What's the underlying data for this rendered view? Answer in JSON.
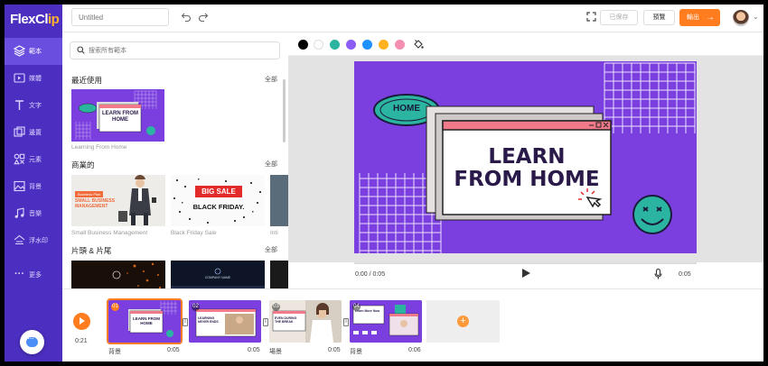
{
  "app": {
    "logo_main": "FlexCl",
    "logo_accent": "ip"
  },
  "sidebar": {
    "items": [
      {
        "label": "範本",
        "icon": "layers-icon"
      },
      {
        "label": "媒體",
        "icon": "media-icon"
      },
      {
        "label": "文字",
        "icon": "text-icon"
      },
      {
        "label": "邊置",
        "icon": "overlay-icon"
      },
      {
        "label": "元素",
        "icon": "elements-icon"
      },
      {
        "label": "背景",
        "icon": "background-icon"
      },
      {
        "label": "音樂",
        "icon": "music-icon"
      },
      {
        "label": "浮水印",
        "icon": "watermark-icon"
      },
      {
        "label": "更多",
        "icon": "more-icon"
      }
    ],
    "active_index": 0
  },
  "topbar": {
    "title_placeholder": "Untitled",
    "saved_label": "已保存",
    "preview_label": "預覽",
    "export_label": "輸出"
  },
  "library": {
    "search_placeholder": "搜索所有範本",
    "sections": [
      {
        "title": "最近使用",
        "all_label": "全部",
        "items": [
          {
            "caption": "Learning From Home"
          }
        ]
      },
      {
        "title": "商業的",
        "all_label": "全部",
        "items": [
          {
            "caption": "Small Business Management"
          },
          {
            "caption": "Black Friday Sale"
          },
          {
            "caption": "Inti"
          }
        ]
      },
      {
        "title": "片頭 & 片尾",
        "all_label": "全部"
      }
    ],
    "thumb_texts": {
      "learn": "LEARN FROM HOME",
      "business_tag": "Business Plan",
      "business": "SMALL BUSINESS MANAGEMENT",
      "big_sale": "BIG SALE",
      "black_friday": "BLACK FRIDAY.",
      "company": "COMPANY NAME"
    }
  },
  "colors": {
    "palette": [
      "#000000",
      "#ffffff",
      "#2bb5a0",
      "#8b5cf6",
      "#1e90ff",
      "#ffb21e",
      "#f48fb1"
    ],
    "accent": "#ff7c1f",
    "brand": "#4c2fc0"
  },
  "canvas": {
    "home_label": "HOME",
    "headline_line1": "LEARN",
    "headline_line2": "FROM HOME"
  },
  "player": {
    "time_current": "0:00 / 0:05",
    "time_total": "0:05"
  },
  "timeline": {
    "current_time": "0:21",
    "clips": [
      {
        "num": "01",
        "label": "背景",
        "duration": "0:05",
        "text": "LEARN FROM HOME"
      },
      {
        "num": "02",
        "label": "",
        "duration": "0:05",
        "text": "LEARNING NEVER ENDS"
      },
      {
        "num": "03",
        "label": "場景",
        "duration": "0:05",
        "text": "EVEN DURING THE BREAK"
      },
      {
        "num": "04",
        "label": "背景",
        "duration": "0:06",
        "text": "Learn More Now"
      }
    ]
  }
}
